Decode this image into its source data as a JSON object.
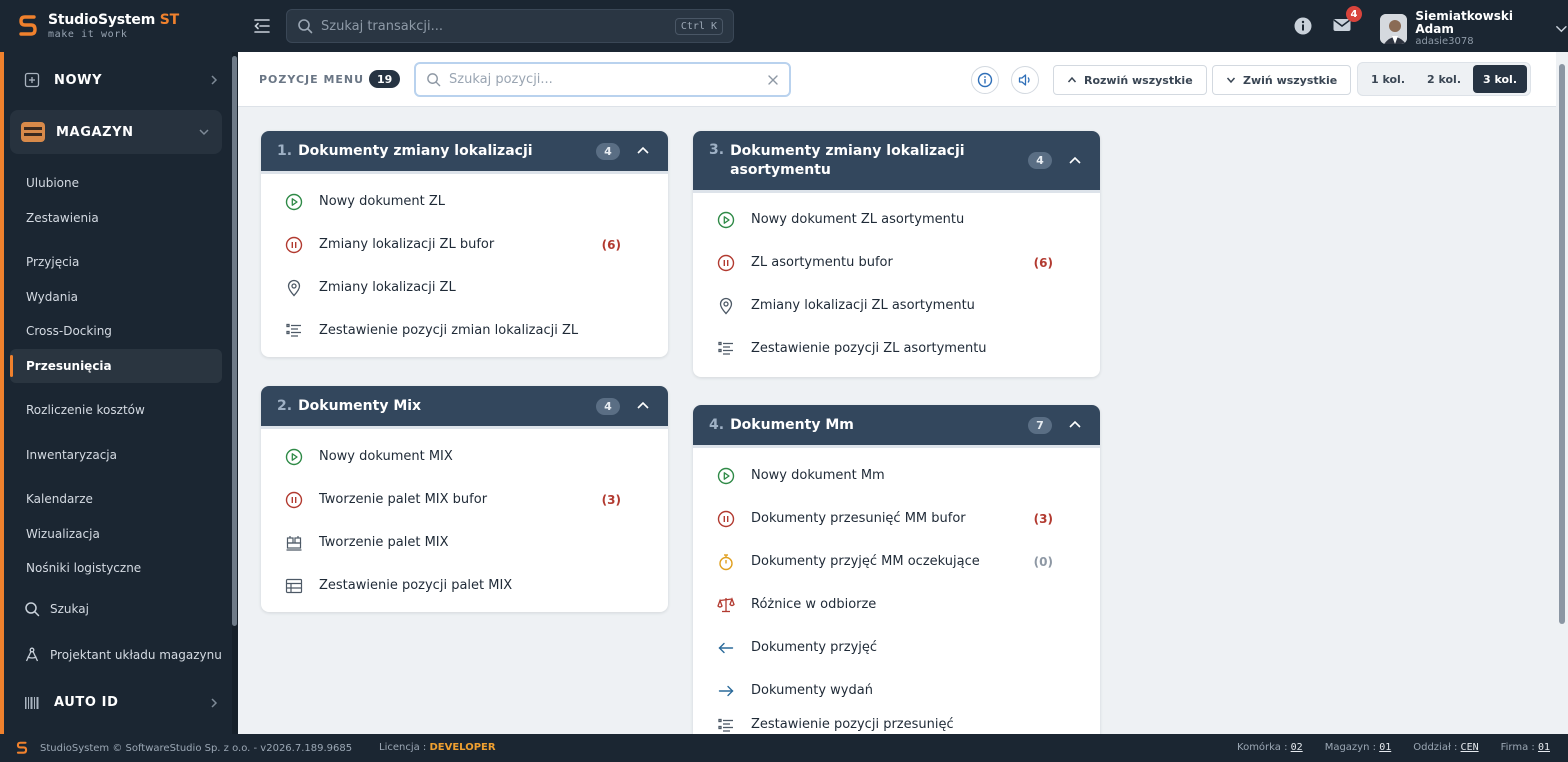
{
  "app": {
    "name": "StudioSystem",
    "name_suffix": "ST",
    "tagline": "make it work",
    "accent": "#f0812d"
  },
  "topbar": {
    "search_placeholder": "Szukaj transakcji...",
    "shortcut": "Ctrl K",
    "mail_badge": "4",
    "user_name": "Siemiatkowski Adam",
    "user_login": "adasie3078"
  },
  "sidebar": {
    "new_label": "NOWY",
    "magazyn_label": "MAGAZYN",
    "items": [
      {
        "label": "Ulubione"
      },
      {
        "label": "Zestawienia"
      },
      {
        "label": "Przyjęcia"
      },
      {
        "label": "Wydania"
      },
      {
        "label": "Cross-Docking"
      },
      {
        "label": "Przesunięcia"
      },
      {
        "label": "Rozliczenie kosztów"
      },
      {
        "label": "Inwentaryzacja"
      },
      {
        "label": "Kalendarze"
      },
      {
        "label": "Wizualizacja"
      },
      {
        "label": "Nośniki logistyczne"
      }
    ],
    "search_label": "Szukaj",
    "designer_label": "Projektant układu magazynu",
    "autoid_label": "AUTO ID"
  },
  "toolbar": {
    "label": "POZYCJE MENU",
    "count": "19",
    "search_placeholder": "Szukaj pozycji...",
    "expand_all": "Rozwiń wszystkie",
    "collapse_all": "Zwiń wszystkie",
    "columns": [
      {
        "label": "1 kol."
      },
      {
        "label": "2 kol."
      },
      {
        "label": "3 kol."
      }
    ],
    "active_columns": "3 kol."
  },
  "cards": [
    {
      "number": "1.",
      "title": "Dokumenty zmiany lokalizacji",
      "count": "4",
      "rows": [
        {
          "icon": "play-circle-icon",
          "label": "Nowy dokument ZL",
          "count": ""
        },
        {
          "icon": "pause-circle-icon",
          "label": "Zmiany lokalizacji ZL bufor",
          "count": "(6)"
        },
        {
          "icon": "location-pin-icon",
          "label": "Zmiany lokalizacji ZL",
          "count": ""
        },
        {
          "icon": "list-icon",
          "label": "Zestawienie pozycji zmian lokalizacji ZL",
          "count": ""
        }
      ]
    },
    {
      "number": "2.",
      "title": "Dokumenty Mix",
      "count": "4",
      "rows": [
        {
          "icon": "play-circle-icon",
          "label": "Nowy dokument MIX",
          "count": ""
        },
        {
          "icon": "pause-circle-icon",
          "label": "Tworzenie palet MIX bufor",
          "count": "(3)"
        },
        {
          "icon": "pallet-boxes-icon",
          "label": "Tworzenie palet MIX",
          "count": ""
        },
        {
          "icon": "table-icon",
          "label": "Zestawienie pozycji palet MIX",
          "count": ""
        }
      ]
    },
    {
      "number": "3.",
      "title": "Dokumenty zmiany lokalizacji asortymentu",
      "count": "4",
      "rows": [
        {
          "icon": "play-circle-icon",
          "label": "Nowy dokument ZL asortymentu",
          "count": ""
        },
        {
          "icon": "pause-circle-icon",
          "label": "ZL asortymentu bufor",
          "count": "(6)"
        },
        {
          "icon": "location-pin-icon",
          "label": "Zmiany lokalizacji ZL asortymentu",
          "count": ""
        },
        {
          "icon": "list-icon",
          "label": "Zestawienie pozycji ZL asortymentu",
          "count": ""
        }
      ]
    },
    {
      "number": "4.",
      "title": "Dokumenty Mm",
      "count": "7",
      "rows": [
        {
          "icon": "play-circle-icon",
          "label": "Nowy dokument Mm",
          "count": ""
        },
        {
          "icon": "pause-circle-icon",
          "label": "Dokumenty przesunięć MM bufor",
          "count": "(3)"
        },
        {
          "icon": "stopwatch-icon",
          "label": "Dokumenty przyjęć MM oczekujące",
          "count": "(0)"
        },
        {
          "icon": "scale-icon",
          "label": "Różnice w odbiorze",
          "count": ""
        },
        {
          "icon": "arrow-left-icon",
          "label": "Dokumenty przyjęć",
          "count": ""
        },
        {
          "icon": "arrow-right-icon",
          "label": "Dokumenty wydań",
          "count": ""
        },
        {
          "icon": "list-icon",
          "label": "Zestawienie pozycji przesunięć",
          "count": ""
        }
      ]
    }
  ],
  "footer": {
    "copyright": "StudioSystem © SoftwareStudio Sp. z o.o. - v2026.7.189.9685",
    "license_label": "Licencja :",
    "license_value": "DEVELOPER",
    "fields": [
      {
        "label": "Komórka :",
        "value": "02"
      },
      {
        "label": "Magazyn :",
        "value": "01"
      },
      {
        "label": "Oddział :",
        "value": "CEN"
      },
      {
        "label": "Firma :",
        "value": "01"
      }
    ]
  }
}
